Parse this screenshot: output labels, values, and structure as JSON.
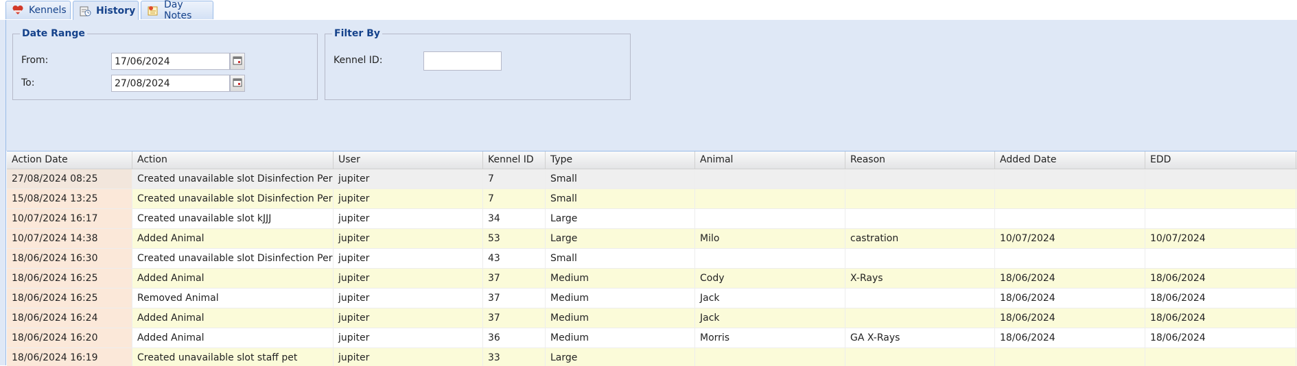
{
  "tabs": [
    {
      "label": "Kennels",
      "icon": "kennels-icon",
      "active": false
    },
    {
      "label": "History",
      "icon": "history-icon",
      "active": true
    },
    {
      "label": "Day Notes",
      "icon": "day-notes-icon",
      "active": false
    }
  ],
  "date_range": {
    "legend": "Date Range",
    "from_label": "From:",
    "from_value": "17/06/2024",
    "to_label": "To:",
    "to_value": "27/08/2024"
  },
  "filter_by": {
    "legend": "Filter By",
    "kennel_label": "Kennel ID:",
    "kennel_value": ""
  },
  "grid": {
    "columns": [
      "Action Date",
      "Action",
      "User",
      "Kennel ID",
      "Type",
      "Animal",
      "Reason",
      "Added Date",
      "EDD"
    ],
    "rows": [
      [
        "27/08/2024 08:25",
        "Created unavailable slot Disinfection Period",
        "jupiter",
        "7",
        "Small",
        "",
        "",
        "",
        ""
      ],
      [
        "15/08/2024 13:25",
        "Created unavailable slot Disinfection Period",
        "jupiter",
        "7",
        "Small",
        "",
        "",
        "",
        ""
      ],
      [
        "10/07/2024 16:17",
        "Created unavailable slot kJJJ",
        "jupiter",
        "34",
        "Large",
        "",
        "",
        "",
        ""
      ],
      [
        "10/07/2024 14:38",
        "Added Animal",
        "jupiter",
        "53",
        "Large",
        "Milo",
        "castration",
        "10/07/2024",
        "10/07/2024"
      ],
      [
        "18/06/2024 16:30",
        "Created unavailable slot Disinfection Period",
        "jupiter",
        "43",
        "Small",
        "",
        "",
        "",
        ""
      ],
      [
        "18/06/2024 16:25",
        "Added Animal",
        "jupiter",
        "37",
        "Medium",
        "Cody",
        "X-Rays",
        "18/06/2024",
        "18/06/2024"
      ],
      [
        "18/06/2024 16:25",
        "Removed Animal",
        "jupiter",
        "37",
        "Medium",
        "Jack",
        "",
        "18/06/2024",
        "18/06/2024"
      ],
      [
        "18/06/2024 16:24",
        "Added Animal",
        "jupiter",
        "37",
        "Medium",
        "Jack",
        "",
        "18/06/2024",
        "18/06/2024"
      ],
      [
        "18/06/2024 16:20",
        "Added Animal",
        "jupiter",
        "36",
        "Medium",
        "Morris",
        "GA X-Rays",
        "18/06/2024",
        "18/06/2024"
      ],
      [
        "18/06/2024 16:19",
        "Created unavailable slot staff pet",
        "jupiter",
        "33",
        "Large",
        "",
        "",
        "",
        ""
      ]
    ]
  }
}
